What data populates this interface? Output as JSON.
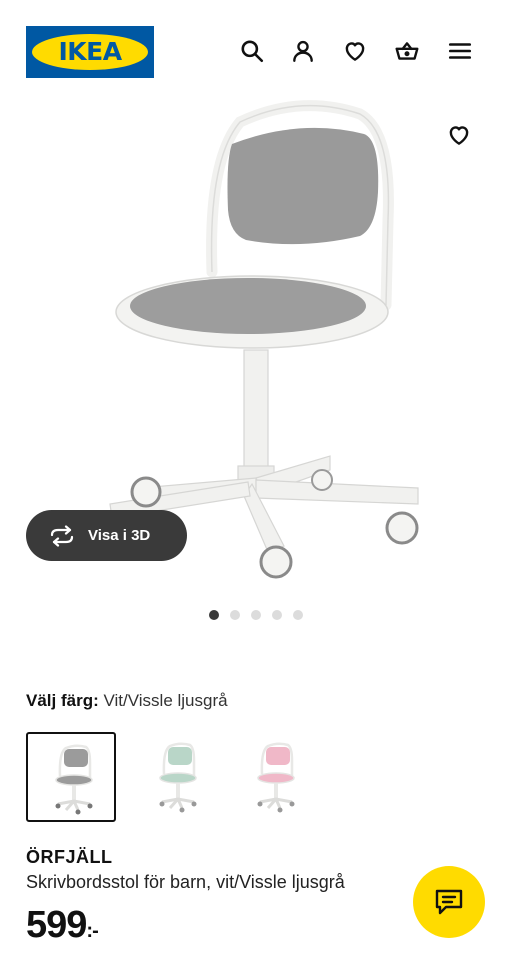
{
  "header": {
    "logo_text": "IKEA",
    "icons": [
      "search-icon",
      "user-icon",
      "heart-icon",
      "basket-icon",
      "menu-icon"
    ]
  },
  "gallery": {
    "view_3d_label": "Visa i 3D",
    "image_count": 5,
    "active_index": 0
  },
  "color_picker": {
    "label": "Välj färg:",
    "selected_value": "Vit/Vissle ljusgrå",
    "options": [
      {
        "seat_color": "#9b9b9b",
        "selected": true
      },
      {
        "seat_color": "#b9d6c8",
        "selected": false
      },
      {
        "seat_color": "#f0b8c8",
        "selected": false
      }
    ]
  },
  "product": {
    "name": "ÖRFJÄLL",
    "description": "Skrivbordsstol för barn, vit/Vissle ljusgrå",
    "price": "599",
    "price_suffix": ":-"
  },
  "colors": {
    "brand_blue": "#0058a3",
    "brand_yellow": "#ffdb00",
    "pill_dark": "#3a3a3a"
  }
}
